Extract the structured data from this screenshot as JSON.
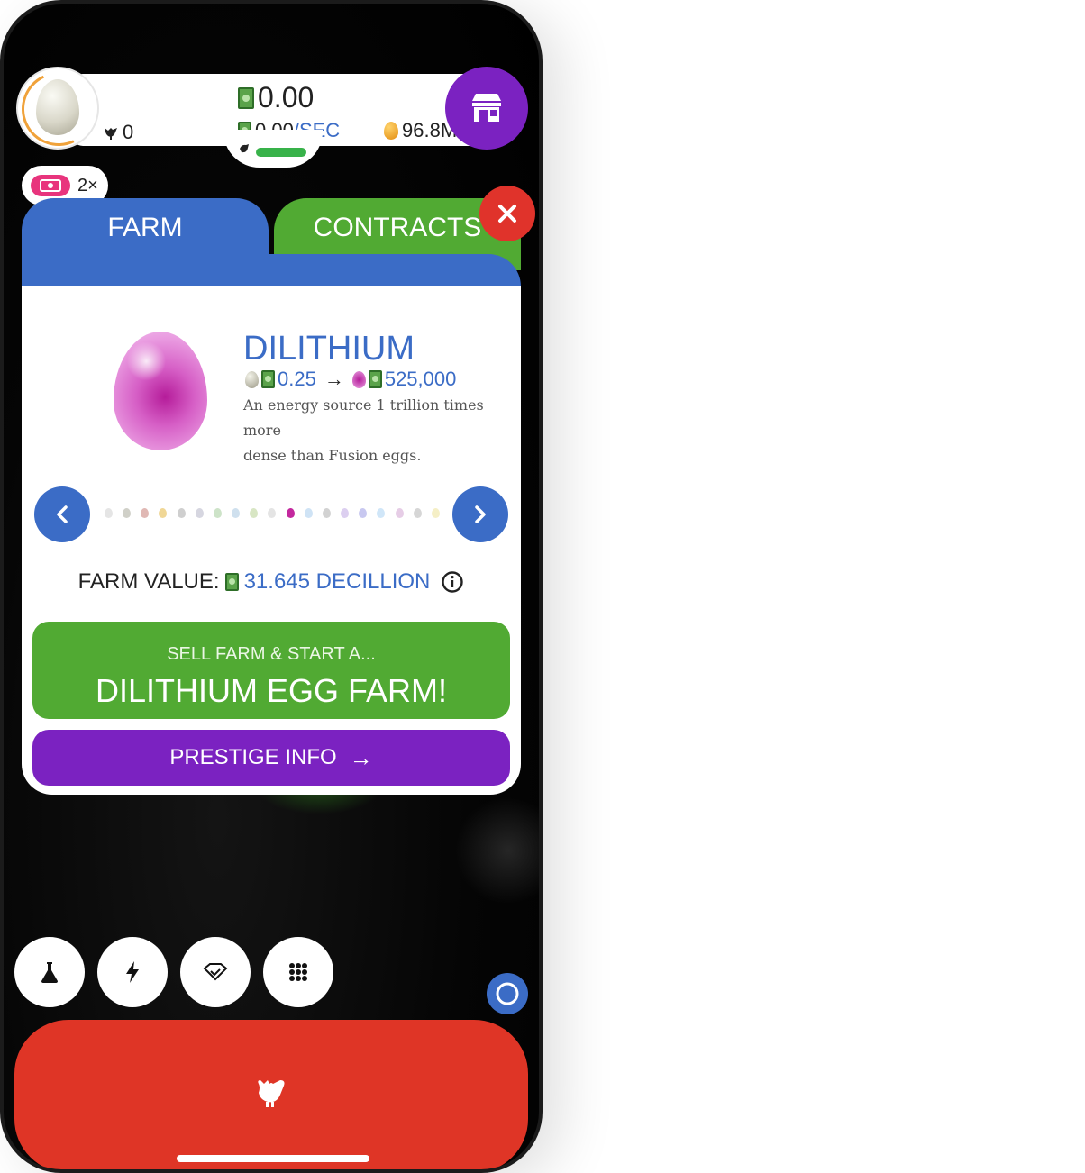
{
  "header": {
    "cash": "0.00",
    "cash_rate": "0.00",
    "cash_rate_unit": "/SEC",
    "chickens": "0",
    "eggs": "96.8M",
    "boost_multiplier": "2×"
  },
  "tabs": [
    {
      "label": "FARM",
      "active": true
    },
    {
      "label": "CONTRACTS",
      "active": false
    }
  ],
  "egg": {
    "name": "DILITHIUM",
    "from_value": "0.25",
    "arrow": "→",
    "to_value": "525,000",
    "description_line1": "An energy source 1 trillion times more",
    "description_line2": "dense than Fusion eggs."
  },
  "farm_value": {
    "label": "FARM VALUE:",
    "value": "31.645 DECILLION"
  },
  "sell_button": {
    "line1": "SELL FARM & START A...",
    "line2": "DILITHIUM EGG FARM!"
  },
  "prestige_button": {
    "label": "PRESTIGE INFO",
    "arrow": "→"
  },
  "bottom_buttons": [
    "flask-icon",
    "lightning-icon",
    "gem-icon",
    "grid-icon"
  ],
  "colors": {
    "blue": "#3b6cc6",
    "green": "#51aa33",
    "purple": "#7b22c1",
    "red": "#df3526",
    "pink": "#e8347d"
  }
}
